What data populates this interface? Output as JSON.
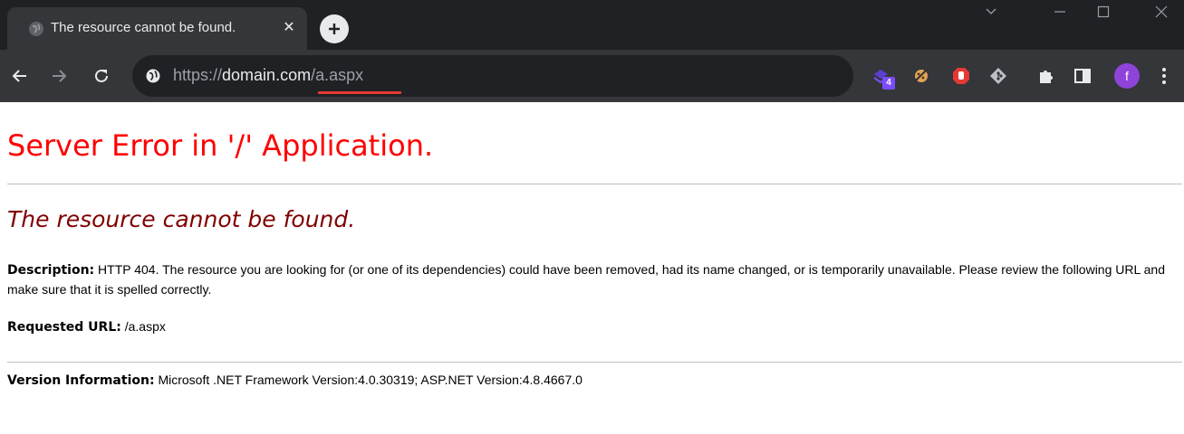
{
  "browser": {
    "tab": {
      "title": "The resource cannot be found.",
      "close_glyph": "✕"
    },
    "url": {
      "scheme": "https://",
      "host": "domain.com",
      "path": "/a.aspx"
    },
    "extensions": [
      {
        "icon": "stack-extension-icon",
        "badge": "4",
        "color": "#7c4dff"
      },
      {
        "icon": "cookie-extension-icon",
        "color": "#f0c070"
      },
      {
        "icon": "stop-hand-extension-icon",
        "color": "#e53935"
      },
      {
        "icon": "git-extension-icon",
        "color": "#bdc1c6"
      },
      {
        "icon": "puzzle-icon",
        "color": "#e8eaed"
      },
      {
        "icon": "side-panel-icon",
        "color": "#e8eaed"
      }
    ],
    "profile": {
      "initial": "f",
      "color": "#8e44d9"
    },
    "colors": {
      "frame": "#202124",
      "toolbar": "#35363a",
      "accent_underline": "#e53935"
    }
  },
  "page": {
    "heading": "Server Error in '/' Application.",
    "subheading": "The resource cannot be found.",
    "description_label": "Description:",
    "description_text": "HTTP 404. The resource you are looking for (or one of its dependencies) could have been removed, had its name changed, or is temporarily unavailable.  Please review the following URL and make sure that it is spelled correctly.",
    "requested_url_label": "Requested URL:",
    "requested_url_value": "/a.aspx",
    "version_label": "Version Information:",
    "version_value": "Microsoft .NET Framework Version:4.0.30319; ASP.NET Version:4.8.4667.0",
    "colors": {
      "heading": "#ff0000",
      "subheading": "#800000"
    }
  }
}
